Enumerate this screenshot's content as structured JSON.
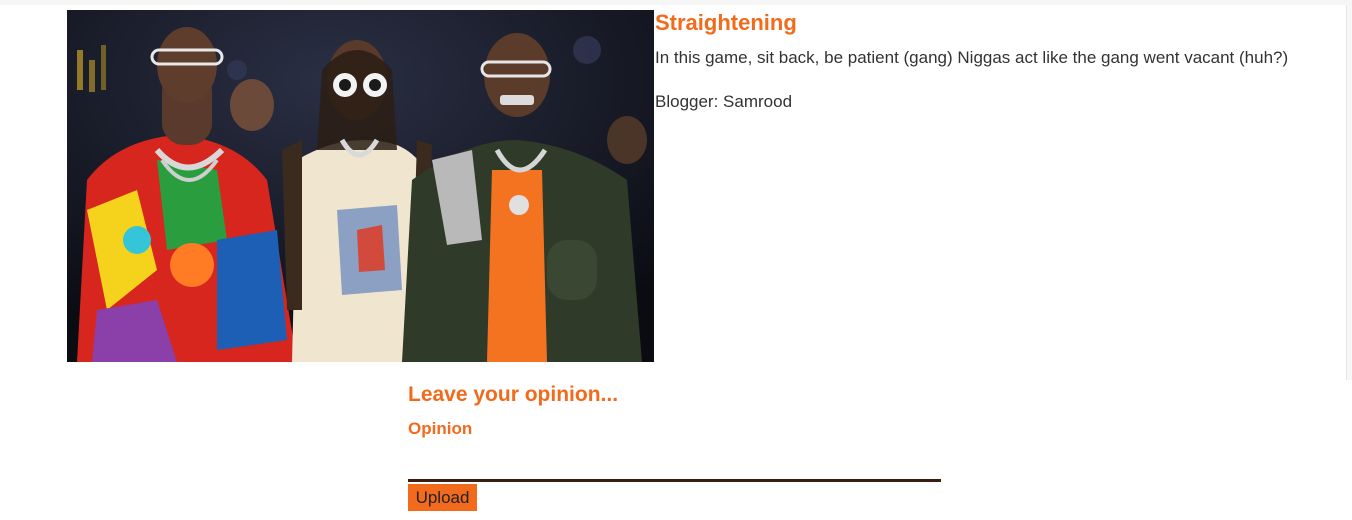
{
  "post": {
    "title": "Straightening",
    "body": "In this game, sit back, be patient (gang) Niggas act like the gang went vacant (huh?)",
    "author": "Blogger: Samrood"
  },
  "comment_form": {
    "heading": "Leave your opinion...",
    "field_label": "Opinion",
    "field_value": "",
    "submit_label": "Upload"
  },
  "colors": {
    "accent": "#f26a1b",
    "text": "#333333",
    "input_underline": "#3a1d10"
  }
}
